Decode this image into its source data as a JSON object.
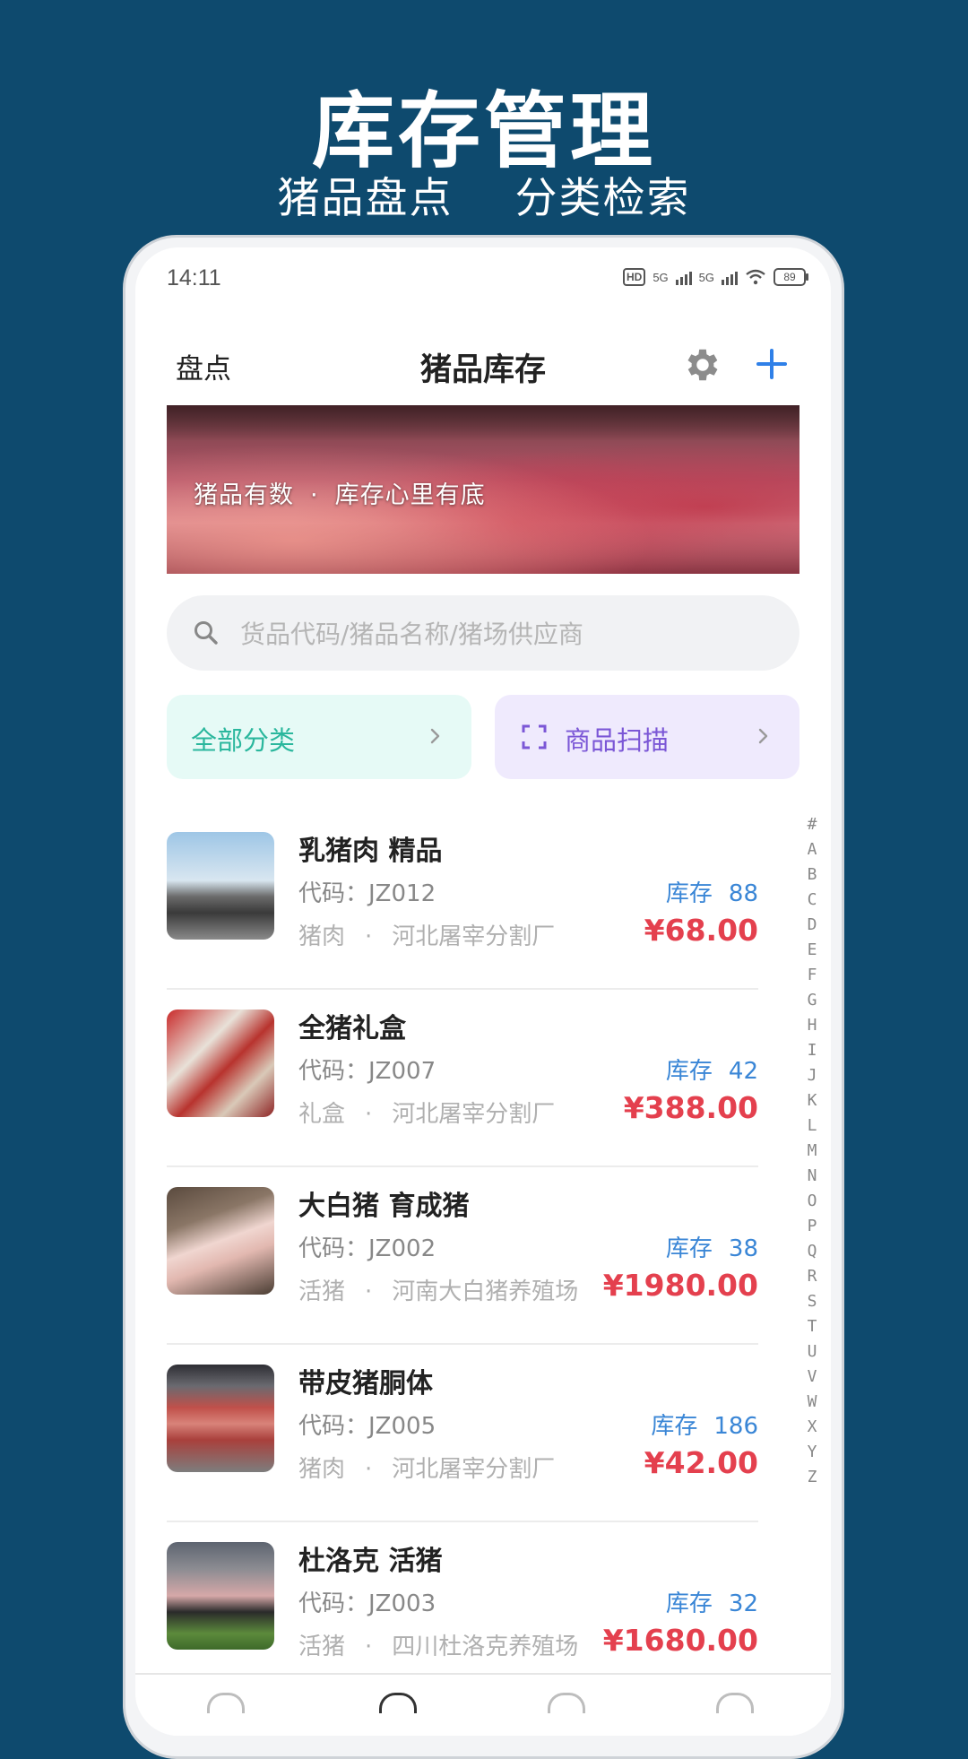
{
  "promo": {
    "title": "库存管理",
    "subtitle_left": "猪品盘点",
    "subtitle_right": "分类检索"
  },
  "status": {
    "time": "14:11",
    "hd": "HD",
    "sig1": "5G",
    "sig2": "5G",
    "battery": "89"
  },
  "nav": {
    "left": "盘点",
    "title": "猪品库存",
    "settings_icon": "gear-icon",
    "add_icon": "plus-icon"
  },
  "banner": {
    "text_left": "猪品有数",
    "dot": "·",
    "text_right": "库存心里有底"
  },
  "search": {
    "placeholder": "货品代码/猪品名称/猪场供应商"
  },
  "category": {
    "all_label": "全部分类",
    "scan_label": "商品扫描"
  },
  "products": [
    {
      "name": "乳猪肉 精品",
      "code": "代码：JZ012",
      "type": "猪肉",
      "dot": "·",
      "supplier": "河北屠宰分割厂",
      "stock_label": "库存",
      "stock": "88",
      "price": "¥68.00"
    },
    {
      "name": "全猪礼盒",
      "code": "代码：JZ007",
      "type": "礼盒",
      "dot": "·",
      "supplier": "河北屠宰分割厂",
      "stock_label": "库存",
      "stock": "42",
      "price": "¥388.00"
    },
    {
      "name": "大白猪 育成猪",
      "code": "代码：JZ002",
      "type": "活猪",
      "dot": "·",
      "supplier": "河南大白猪养殖场",
      "stock_label": "库存",
      "stock": "38",
      "price": "¥1980.00"
    },
    {
      "name": "带皮猪胴体",
      "code": "代码：JZ005",
      "type": "猪肉",
      "dot": "·",
      "supplier": "河北屠宰分割厂",
      "stock_label": "库存",
      "stock": "186",
      "price": "¥42.00"
    },
    {
      "name": "杜洛克 活猪",
      "code": "代码：JZ003",
      "type": "活猪",
      "dot": "·",
      "supplier": "四川杜洛克养殖场",
      "stock_label": "库存",
      "stock": "32",
      "price": "¥1680.00"
    }
  ],
  "alphabet": [
    "#",
    "A",
    "B",
    "C",
    "D",
    "E",
    "F",
    "G",
    "H",
    "I",
    "J",
    "K",
    "L",
    "M",
    "N",
    "O",
    "P",
    "Q",
    "R",
    "S",
    "T",
    "U",
    "V",
    "W",
    "X",
    "Y",
    "Z"
  ],
  "colors": {
    "background": "#0e4a6e",
    "accent_blue": "#3a86d6",
    "price_red": "#e4404e",
    "teal": "#2bb79d",
    "purple": "#7b57d6"
  }
}
